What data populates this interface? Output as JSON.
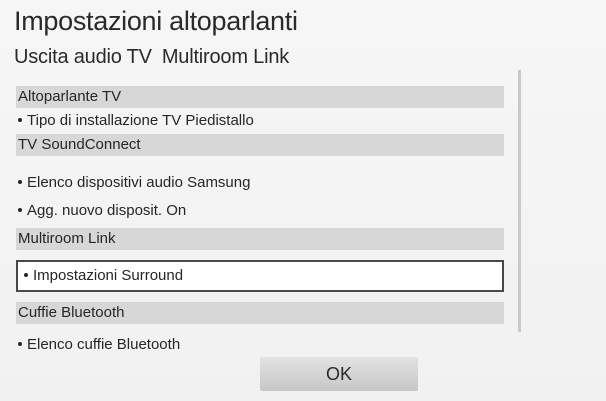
{
  "dialog": {
    "title": "Impostazioni altoparlanti",
    "subtitle_parts": [
      "Uscita audio TV",
      "Multiroom Link"
    ]
  },
  "sections": [
    {
      "header": "Altoparlante TV",
      "items": [
        "Tipo di installazione TV Piedistallo"
      ]
    },
    {
      "header": "TV SoundConnect",
      "items": [
        "Elenco dispositivi audio Samsung",
        "Agg. nuovo disposit. On"
      ]
    },
    {
      "header": "Multiroom Link",
      "items": [
        "Impostazioni Surround"
      ],
      "selected_item": "Impostazioni Surround"
    },
    {
      "header": "Cuffie Bluetooth",
      "items": [
        "Elenco cuffie Bluetooth"
      ]
    }
  ],
  "buttons": {
    "ok": "OK"
  }
}
